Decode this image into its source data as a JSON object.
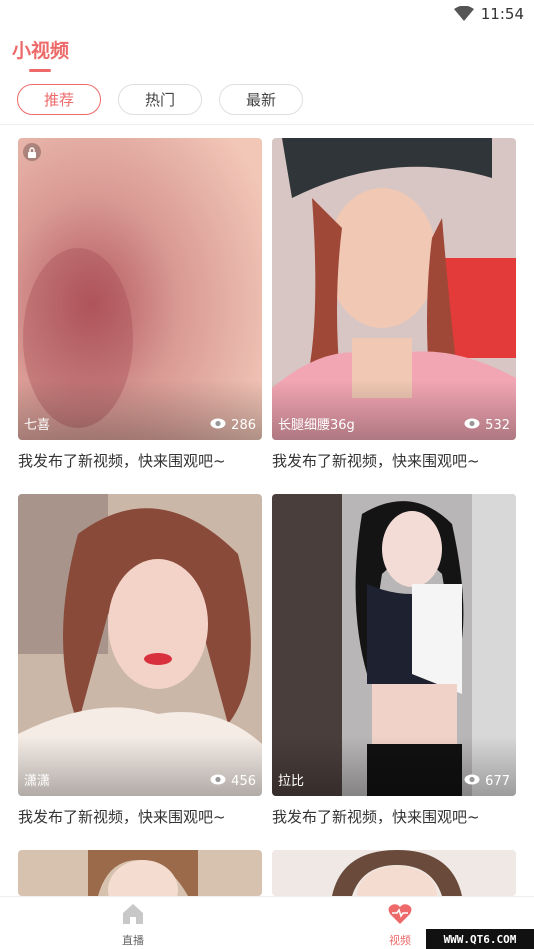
{
  "status_bar": {
    "time": "11:54",
    "wifi_icon": "wifi-icon"
  },
  "header": {
    "title": "小视频"
  },
  "tabs": [
    {
      "label": "推荐",
      "active": true
    },
    {
      "label": "热门",
      "active": false
    },
    {
      "label": "最新",
      "active": false
    }
  ],
  "cards": [
    {
      "name": "七喜",
      "views": "286",
      "caption": "我发布了新视频，快来围观吧~",
      "locked": true
    },
    {
      "name": "长腿细腰36g",
      "views": "532",
      "caption": "我发布了新视频，快来围观吧~",
      "locked": false
    },
    {
      "name": "潇潇",
      "views": "456",
      "caption": "我发布了新视频，快来围观吧~",
      "locked": false
    },
    {
      "name": "拉比",
      "views": "677",
      "caption": "我发布了新视频，快来围观吧~",
      "locked": false
    },
    {
      "name": "",
      "views": "",
      "caption": "",
      "locked": false
    },
    {
      "name": "",
      "views": "",
      "caption": "",
      "locked": false
    }
  ],
  "bottom_nav": [
    {
      "label": "直播",
      "icon": "home-icon",
      "active": false
    },
    {
      "label": "视频",
      "icon": "heartbeat-icon",
      "active": true
    }
  ],
  "watermark": "WWW.QT6.COM",
  "colors": {
    "accent": "#ee6a6a"
  }
}
